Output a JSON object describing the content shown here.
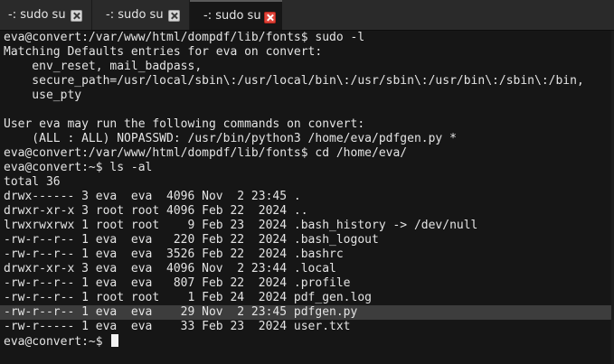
{
  "tabs": [
    {
      "label": "-: sudo su",
      "active": false
    },
    {
      "label": "-: sudo su",
      "active": false
    },
    {
      "label": "-: sudo su",
      "active": true
    }
  ],
  "terminal": {
    "lines": [
      "eva@convert:/var/www/html/dompdf/lib/fonts$ sudo -l",
      "Matching Defaults entries for eva on convert:",
      "    env_reset, mail_badpass,",
      "    secure_path=/usr/local/sbin\\:/usr/local/bin\\:/usr/sbin\\:/usr/bin\\:/sbin\\:/bin,",
      "    use_pty",
      "",
      "User eva may run the following commands on convert:",
      "    (ALL : ALL) NOPASSWD: /usr/bin/python3 /home/eva/pdfgen.py *",
      "eva@convert:/var/www/html/dompdf/lib/fonts$ cd /home/eva/",
      "eva@convert:~$ ls -al",
      "total 36",
      "drwx------ 3 eva  eva  4096 Nov  2 23:45 .",
      "drwxr-xr-x 3 root root 4096 Feb 22  2024 ..",
      "lrwxrwxrwx 1 root root    9 Feb 23  2024 .bash_history -> /dev/null",
      "-rw-r--r-- 1 eva  eva   220 Feb 22  2024 .bash_logout",
      "-rw-r--r-- 1 eva  eva  3526 Feb 22  2024 .bashrc",
      "drwxr-xr-x 3 eva  eva  4096 Nov  2 23:44 .local",
      "-rw-r--r-- 1 eva  eva   807 Feb 22  2024 .profile",
      "-rw-r--r-- 1 root root    1 Feb 24  2024 pdf_gen.log",
      "-rw-r--r-- 1 eva  eva    29 Nov  2 23:45 pdfgen.py",
      "-rw-r----- 1 eva  eva    33 Feb 23  2024 user.txt"
    ],
    "prompt": "eva@convert:~$ "
  }
}
